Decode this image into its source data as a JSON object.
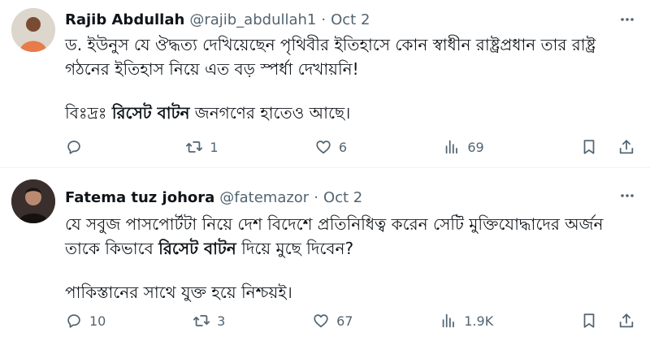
{
  "tweets": [
    {
      "author_name": "Rajib Abdullah",
      "handle": "@rajib_abdullah1",
      "separator": "·",
      "date": "Oct 2",
      "text": {
        "line1": "ড. ইউনুস যে ঔদ্ধত্য দেখিয়েছেন পৃথিবীর ইতিহাসে কোন স্বাধীন রাষ্ট্রপ্রধান তার রাষ্ট্র গঠনের ইতিহাস নিয়ে এত বড় স্পর্ধা দেখায়নি!",
        "p2_prefix": "বিঃদ্রঃ ",
        "p2_bold": "রিসেট বাটন",
        "p2_suffix": " জনগণের হাতেও আছে।"
      },
      "stats": {
        "replies": "",
        "reposts": "1",
        "likes": "6",
        "views": "69"
      }
    },
    {
      "author_name": "Fatema tuz johora",
      "handle": "@fatemazor",
      "separator": "·",
      "date": "Oct 2",
      "text": {
        "p1_prefix": "যে সবুজ পাসপোর্টটা  নিয়ে দেশ বিদেশে প্রতিনিধিত্ব করেন সেটি মুক্তিযোদ্ধাদের অর্জন তাকে কিভাবে ",
        "p1_bold": "রিসেট বাটন",
        "p1_suffix": " দিয়ে মুছে দিবেন?",
        "p2": "পাকিস্তানের সাথে যুক্ত হয়ে নিশ্চয়ই।"
      },
      "stats": {
        "replies": "10",
        "reposts": "3",
        "likes": "67",
        "views": "1.9K"
      }
    }
  ],
  "icons": [
    "more-icon",
    "reply-icon",
    "repost-icon",
    "like-icon",
    "views-icon",
    "bookmark-icon",
    "share-icon"
  ],
  "colors": {
    "text": "#0f1419",
    "secondary": "#536471",
    "divider": "#eff3f4"
  }
}
